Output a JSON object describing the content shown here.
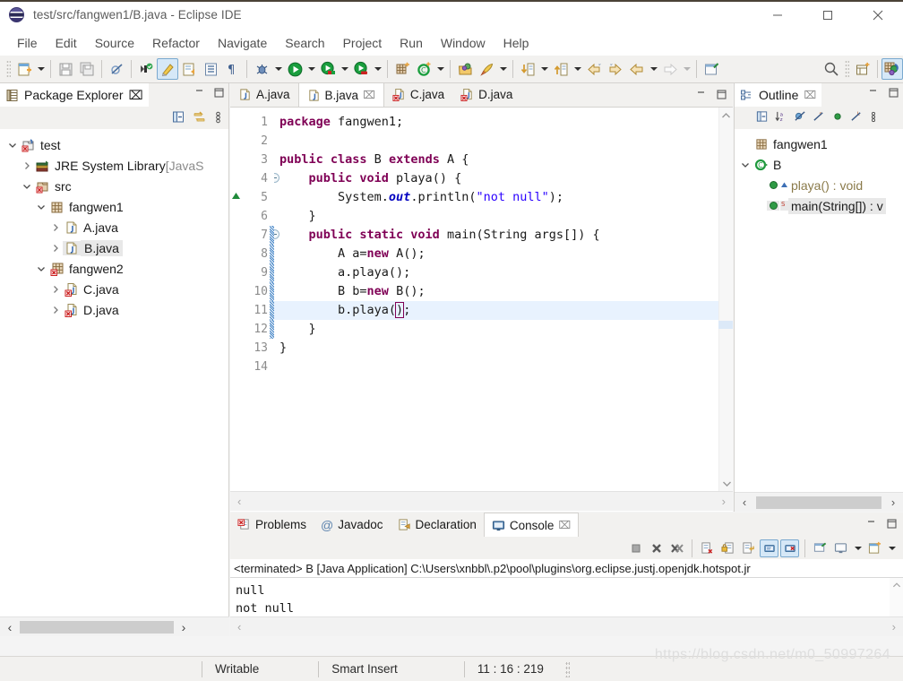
{
  "window": {
    "title": "test/src/fangwen1/B.java - Eclipse IDE",
    "app_icon": "eclipse-logo-icon",
    "minimize_label": "—",
    "maximize_label": "☐",
    "close_label": "✕"
  },
  "menubar": {
    "items": [
      "File",
      "Edit",
      "Source",
      "Refactor",
      "Navigate",
      "Search",
      "Project",
      "Run",
      "Window",
      "Help"
    ]
  },
  "toolbar": {
    "groups": [
      {
        "buttons": [
          {
            "name": "new-wizard-icon",
            "arrow": true
          }
        ]
      },
      {
        "buttons": [
          {
            "name": "save-icon",
            "arrow": false
          },
          {
            "name": "save-all-icon",
            "arrow": false
          }
        ]
      },
      {
        "buttons": [
          {
            "name": "skip-all-breakpoints-icon",
            "arrow": false
          }
        ]
      },
      {
        "buttons": [
          {
            "name": "new-java-package-icon",
            "arrow": false
          },
          {
            "name": "toggle-mark-occurrences-icon",
            "arrow": false,
            "selected": true
          },
          {
            "name": "open-task-icon",
            "arrow": false
          },
          {
            "name": "open-type-icon",
            "arrow": false
          },
          {
            "name": "show-whitespace-icon",
            "arrow": false
          }
        ]
      },
      {
        "buttons": [
          {
            "name": "debug-icon",
            "arrow": true
          },
          {
            "name": "run-icon",
            "arrow": true
          },
          {
            "name": "run-coverage-icon",
            "arrow": true
          },
          {
            "name": "run-external-tools-icon",
            "arrow": true
          }
        ]
      },
      {
        "buttons": [
          {
            "name": "new-java-package-2-icon",
            "arrow": false
          },
          {
            "name": "new-java-class-icon",
            "arrow": true
          }
        ]
      },
      {
        "buttons": [
          {
            "name": "open-resource-icon",
            "arrow": false
          },
          {
            "name": "search-rocket-icon",
            "arrow": true
          }
        ]
      },
      {
        "buttons": [
          {
            "name": "previous-annotation-icon",
            "arrow": true
          },
          {
            "name": "next-annotation-icon",
            "arrow": true
          }
        ]
      },
      {
        "buttons": [
          {
            "name": "back-navigation-icon",
            "arrow": false
          },
          {
            "name": "forward-navigation-icon",
            "arrow": false
          },
          {
            "name": "back-history-icon",
            "arrow": true
          },
          {
            "name": "forward-history-icon",
            "arrow": true,
            "dim": true
          }
        ]
      },
      {
        "buttons": [
          {
            "name": "new-editor-icon",
            "arrow": false
          }
        ]
      }
    ],
    "right": [
      {
        "name": "quick-access-search-icon"
      },
      {
        "name": "open-perspective-icon"
      },
      {
        "name": "java-perspective-icon",
        "selected": true
      }
    ]
  },
  "package_explorer": {
    "tab_label": "Package Explorer",
    "tab_icon": "package-explorer-icon",
    "close_label": "⌧",
    "minimize_label": "—",
    "maximize_label": "☐",
    "view_icons": [
      "collapse-all-icon",
      "link-with-editor-icon",
      "view-menu-icon"
    ],
    "tree": [
      {
        "label": "test",
        "icon": "java-project-icon",
        "indent": 0,
        "twisty": "down",
        "muted": ""
      },
      {
        "label": "JRE System Library ",
        "icon": "library-icon",
        "indent": 1,
        "twisty": "right",
        "muted": "[JavaS"
      },
      {
        "label": "src",
        "icon": "source-folder-icon",
        "indent": 1,
        "twisty": "down",
        "muted": ""
      },
      {
        "label": "fangwen1",
        "icon": "package-icon",
        "indent": 2,
        "twisty": "down",
        "muted": ""
      },
      {
        "label": "A.java",
        "icon": "java-file-icon",
        "indent": 3,
        "twisty": "right",
        "muted": ""
      },
      {
        "label": "B.java",
        "icon": "java-file-icon",
        "indent": 3,
        "twisty": "right",
        "muted": "",
        "selected": true
      },
      {
        "label": "fangwen2",
        "icon": "package-error-icon",
        "indent": 2,
        "twisty": "down",
        "muted": ""
      },
      {
        "label": "C.java",
        "icon": "java-file-error-icon",
        "indent": 3,
        "twisty": "right",
        "muted": ""
      },
      {
        "label": "D.java",
        "icon": "java-file-error-icon",
        "indent": 3,
        "twisty": "right",
        "muted": ""
      }
    ]
  },
  "editor": {
    "tabs": [
      {
        "label": "A.java",
        "icon": "java-file-icon",
        "active": false,
        "closeable": false
      },
      {
        "label": "B.java",
        "icon": "java-file-icon",
        "active": true,
        "closeable": true,
        "close_label": "⌧"
      },
      {
        "label": "C.java",
        "icon": "java-file-error-icon",
        "active": false,
        "closeable": false
      },
      {
        "label": "D.java",
        "icon": "java-file-error-icon",
        "active": false,
        "closeable": false
      }
    ],
    "minimize_label": "—",
    "maximize_label": "☐",
    "current_line": 11,
    "lines": [
      {
        "n": 1,
        "fold": false,
        "change": false
      },
      {
        "n": 2,
        "fold": false,
        "change": false
      },
      {
        "n": 3,
        "fold": false,
        "change": false
      },
      {
        "n": 4,
        "fold": true,
        "change": false,
        "marker": "overridden-method-marker"
      },
      {
        "n": 5,
        "fold": false,
        "change": false
      },
      {
        "n": 6,
        "fold": false,
        "change": false
      },
      {
        "n": 7,
        "fold": true,
        "change": true
      },
      {
        "n": 8,
        "fold": false,
        "change": true
      },
      {
        "n": 9,
        "fold": false,
        "change": true
      },
      {
        "n": 10,
        "fold": false,
        "change": true
      },
      {
        "n": 11,
        "fold": false,
        "change": true
      },
      {
        "n": 12,
        "fold": false,
        "change": true
      },
      {
        "n": 13,
        "fold": false,
        "change": false
      },
      {
        "n": 14,
        "fold": false,
        "change": false
      }
    ],
    "code_text": [
      "package fangwen1;",
      "",
      "public class B extends A {",
      "    public void playa() {",
      "        System.out.println(\"not null\");",
      "    }",
      "    public static void main(String args[]) {",
      "        A a=new A();",
      "        a.playa();",
      "        B b=new B();",
      "        b.playa();",
      "    }",
      "}",
      ""
    ]
  },
  "outline": {
    "tab_label": "Outline",
    "tab_icon": "outline-icon",
    "close_label": "⌧",
    "minimize_label": "—",
    "maximize_label": "☐",
    "view_icons": [
      "collapse-all-icon",
      "sort-icon",
      "hide-fields-icon",
      "hide-static-icon",
      "hide-nonpublic-icon",
      "hide-local-types-icon",
      "view-menu-icon"
    ],
    "tree": [
      {
        "label": "fangwen1",
        "icon": "package-icon",
        "indent": 1,
        "twisty": "none"
      },
      {
        "label": "B",
        "icon": "class-icon",
        "indent": 0,
        "twisty": "down"
      },
      {
        "label": "playa() : void",
        "icon": "public-method-icon",
        "badge": "override-badge",
        "indent": 2,
        "twisty": "none"
      },
      {
        "label": "main(String[]) : v",
        "icon": "public-method-icon",
        "badge": "static-badge",
        "indent": 2,
        "twisty": "none",
        "selected": true
      }
    ]
  },
  "console": {
    "tabs": [
      {
        "label": "Problems",
        "icon": "problems-icon",
        "active": false
      },
      {
        "label": "Javadoc",
        "icon": "javadoc-icon",
        "active": false
      },
      {
        "label": "Declaration",
        "icon": "declaration-icon",
        "active": false
      },
      {
        "label": "Console",
        "icon": "console-icon",
        "active": true,
        "close_label": "⌧"
      }
    ],
    "minimize_label": "—",
    "maximize_label": "☐",
    "toolbar_icons": [
      {
        "name": "terminate-icon"
      },
      {
        "name": "remove-launch-icon"
      },
      {
        "name": "remove-all-terminated-icon"
      },
      {
        "name": "clear-console-icon"
      },
      {
        "name": "scroll-lock-icon"
      },
      {
        "name": "word-wrap-icon"
      },
      {
        "name": "show-console-on-output-icon",
        "selected": true
      },
      {
        "name": "show-console-on-error-icon",
        "selected": true
      },
      {
        "name": "pin-console-icon"
      },
      {
        "name": "display-selected-console-icon",
        "arrow": true
      },
      {
        "name": "open-console-icon",
        "arrow": true
      }
    ],
    "title": "<terminated> B [Java Application] C:\\Users\\xnbbl\\.p2\\pool\\plugins\\org.eclipse.justj.openjdk.hotspot.jr",
    "output": [
      "null",
      "not null"
    ]
  },
  "statusbar": {
    "writable": "Writable",
    "insert_mode": "Smart Insert",
    "position": "11 : 16 : 219"
  },
  "watermark": "https://blog.csdn.net/m0_50997264"
}
